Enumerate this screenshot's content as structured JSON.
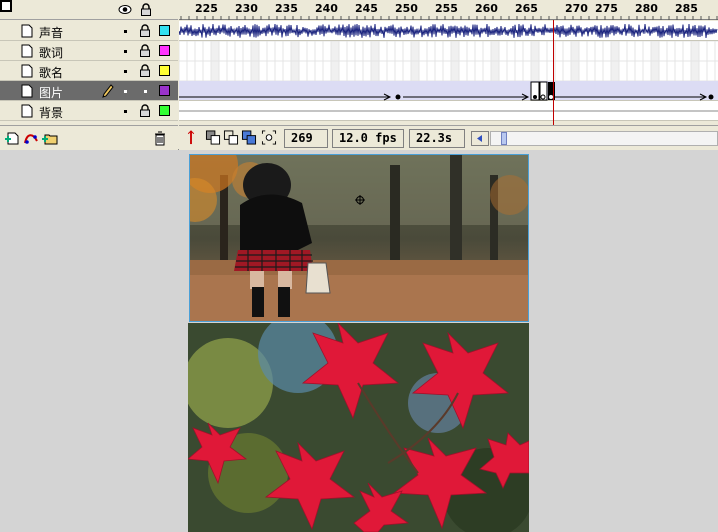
{
  "timeline": {
    "ruler_ticks": [
      "225",
      "230",
      "235",
      "240",
      "245",
      "250",
      "255",
      "260",
      "265",
      "270",
      "275",
      "280",
      "285"
    ],
    "layers": [
      {
        "name": "声音",
        "color": "#34e0f0",
        "selected": false,
        "locked": true
      },
      {
        "name": "歌词",
        "color": "#ff33ff",
        "selected": false,
        "locked": true
      },
      {
        "name": "歌名",
        "color": "#ffff33",
        "selected": false,
        "locked": true
      },
      {
        "name": "图片",
        "color": "#9933cc",
        "selected": true,
        "locked": false
      },
      {
        "name": "背景",
        "color": "#33ff33",
        "selected": false,
        "locked": true
      }
    ],
    "current_frame": "269",
    "frame_rate": "12.0 fps",
    "elapsed_time": "22.3s"
  },
  "icons": {
    "eye": "eye-icon",
    "lock": "lock-icon",
    "outline": "outline-icon",
    "insert_layer": "insert-layer-icon",
    "motion_guide": "add-motion-guide-icon",
    "insert_folder": "insert-folder-icon",
    "delete": "trash-icon",
    "center_frame": "center-frame-icon",
    "onion_skin": "onion-skin-icon",
    "onion_outlines": "onion-skin-outlines-icon",
    "edit_multiple": "edit-multiple-frames-icon",
    "onion_markers": "modify-onion-markers-icon"
  },
  "stage": {
    "photo_top": "girl-in-autumn-forest",
    "photo_bottom": "red-maple-leaves"
  }
}
